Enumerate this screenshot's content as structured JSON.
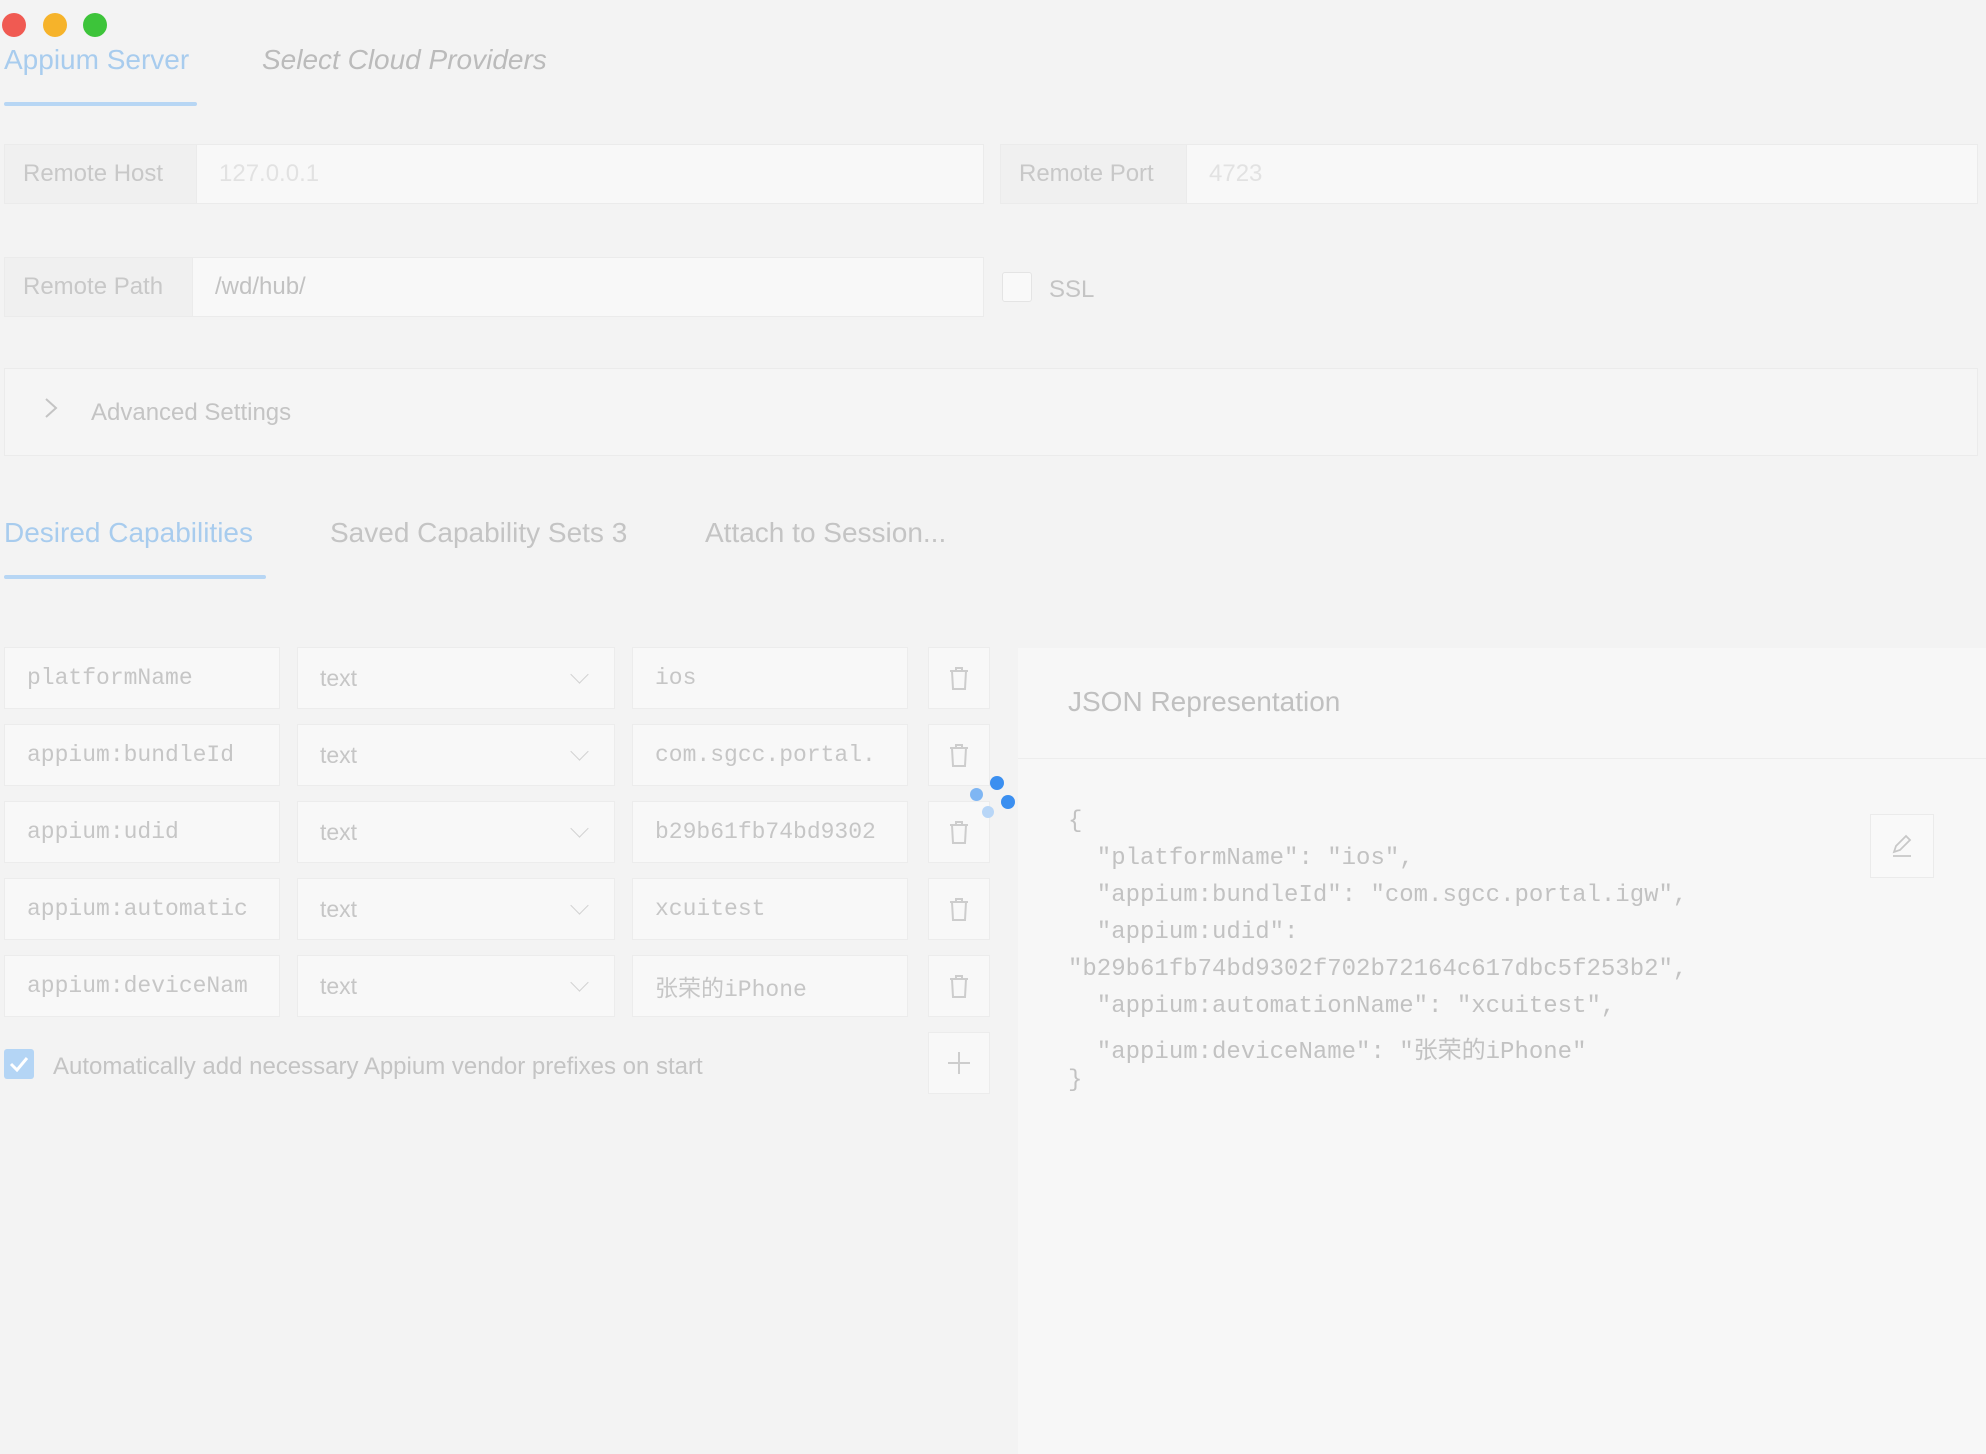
{
  "window": {
    "controls": [
      "close",
      "minimize",
      "maximize"
    ]
  },
  "top_tabs": [
    {
      "label": "Appium Server",
      "active": true
    },
    {
      "label": "Select Cloud Providers",
      "active": false
    }
  ],
  "server": {
    "remote_host_label": "Remote Host",
    "remote_host_placeholder": "127.0.0.1",
    "remote_port_label": "Remote Port",
    "remote_port_placeholder": "4723",
    "remote_path_label": "Remote Path",
    "remote_path_value": "/wd/hub/",
    "ssl_label": "SSL",
    "ssl_checked": false
  },
  "advanced": {
    "label": "Advanced Settings",
    "expanded": false
  },
  "capability_tabs": [
    {
      "label": "Desired Capabilities",
      "active": true
    },
    {
      "label": "Saved Capability Sets 3",
      "active": false
    },
    {
      "label": "Attach to Session...",
      "active": false
    }
  ],
  "capabilities": [
    {
      "name": "platformName",
      "type": "text",
      "value": "ios"
    },
    {
      "name": "appium:bundleId",
      "type": "text",
      "value": "com.sgcc.portal."
    },
    {
      "name": "appium:udid",
      "type": "text",
      "value": "b29b61fb74bd9302"
    },
    {
      "name": "appium:automatic",
      "type": "text",
      "value": "xcuitest"
    },
    {
      "name": "appium:deviceNam",
      "type": "text",
      "value": "张荣的iPhone"
    }
  ],
  "auto_prefix": {
    "label": "Automatically add necessary Appium vendor prefixes on start",
    "checked": true
  },
  "json_panel": {
    "title": "JSON Representation",
    "lines": [
      "{",
      "  \"platformName\": \"ios\",",
      "  \"appium:bundleId\": \"com.sgcc.portal.igw\",",
      "  \"appium:udid\":",
      "\"b29b61fb74bd9302f702b72164c617dbc5f253b2\",",
      "  \"appium:automationName\": \"xcuitest\",",
      "  \"appium:deviceName\": \"张荣的iPhone\"",
      "}"
    ]
  },
  "icons": {
    "delete": "trash-icon",
    "add": "plus-icon",
    "edit": "edit-icon",
    "expand": "chevron-right-icon",
    "select": "chevron-down-icon",
    "loading": "spinner-icon"
  },
  "colors": {
    "accent": "#a8ccee",
    "spinner": "#3b8ff0"
  }
}
